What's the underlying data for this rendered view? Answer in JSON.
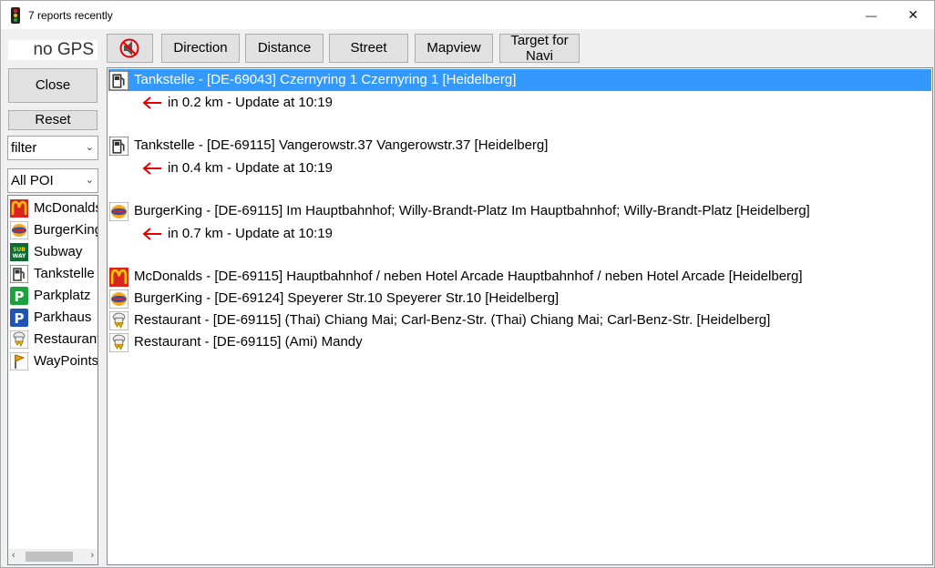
{
  "window": {
    "title": "7 reports recently",
    "minimize_glyph": "—",
    "maximize_glyph": "☐",
    "close_glyph": "✕"
  },
  "sidebar": {
    "gps_status": "no GPS",
    "close_label": "Close",
    "reset_label": "Reset",
    "filter_value": "filter",
    "poi_select_value": "All POI",
    "poi_items": [
      {
        "label": "McDonalds",
        "icon": "mcdonalds-icon"
      },
      {
        "label": "BurgerKing",
        "icon": "burgerking-icon"
      },
      {
        "label": "Subway",
        "icon": "subway-icon"
      },
      {
        "label": "Tankstelle",
        "icon": "fuel-pump-icon"
      },
      {
        "label": "Parkplatz",
        "icon": "parking-icon"
      },
      {
        "label": "Parkhaus",
        "icon": "parking-garage-icon"
      },
      {
        "label": "Restaurant",
        "icon": "restaurant-icon"
      },
      {
        "label": "WayPoints",
        "icon": "waypoint-flag-icon"
      }
    ]
  },
  "toolbar": {
    "mute_icon": "speaker-muted-icon",
    "direction_label": "Direction",
    "distance_label": "Distance",
    "street_label": "Street",
    "mapview_label": "Mapview",
    "target_label_line1": "Target for",
    "target_label_line2": "Navi"
  },
  "results": {
    "rows": [
      {
        "text": "Tankstelle - [DE-69043] Czernyring 1  Czernyring 1 [Heidelberg]",
        "icon": "fuel-pump-icon",
        "selected": true
      },
      {
        "text": "in 0.2 km - Update at 10:19",
        "icon": "left-arrow-icon"
      },
      {
        "text": "Tankstelle - [DE-69115] Vangerowstr.37  Vangerowstr.37 [Heidelberg]",
        "icon": "fuel-pump-icon"
      },
      {
        "text": "in 0.4 km - Update at 10:19",
        "icon": "left-arrow-icon"
      },
      {
        "text": "BurgerKing - [DE-69115] Im Hauptbahnhof; Willy-Brandt-Platz  Im Hauptbahnhof; Willy-Brandt-Platz [Heidelberg]",
        "icon": "burgerking-icon"
      },
      {
        "text": "in 0.7 km - Update at 10:19",
        "icon": "left-arrow-icon"
      },
      {
        "text": "McDonalds - [DE-69115] Hauptbahnhof / neben Hotel Arcade  Hauptbahnhof / neben Hotel Arcade [Heidelberg]",
        "icon": "mcdonalds-icon"
      },
      {
        "text": "BurgerKing - [DE-69124] Speyerer Str.10  Speyerer Str.10 [Heidelberg]",
        "icon": "burgerking-icon"
      },
      {
        "text": "Restaurant - [DE-69115] (Thai) Chiang Mai; Carl-Benz-Str.  (Thai) Chiang Mai; Carl-Benz-Str. [Heidelberg]",
        "icon": "restaurant-icon"
      },
      {
        "text": "Restaurant - [DE-69115] (Ami) Mandy",
        "icon": "restaurant-icon"
      }
    ]
  },
  "colors": {
    "selection": "#3399ff",
    "arrow": "#e00000",
    "mcdonalds_red": "#d8231f",
    "mcdonalds_yellow": "#ffc300",
    "parking_green": "#1aa33b",
    "parking_blue": "#1f55b5"
  }
}
